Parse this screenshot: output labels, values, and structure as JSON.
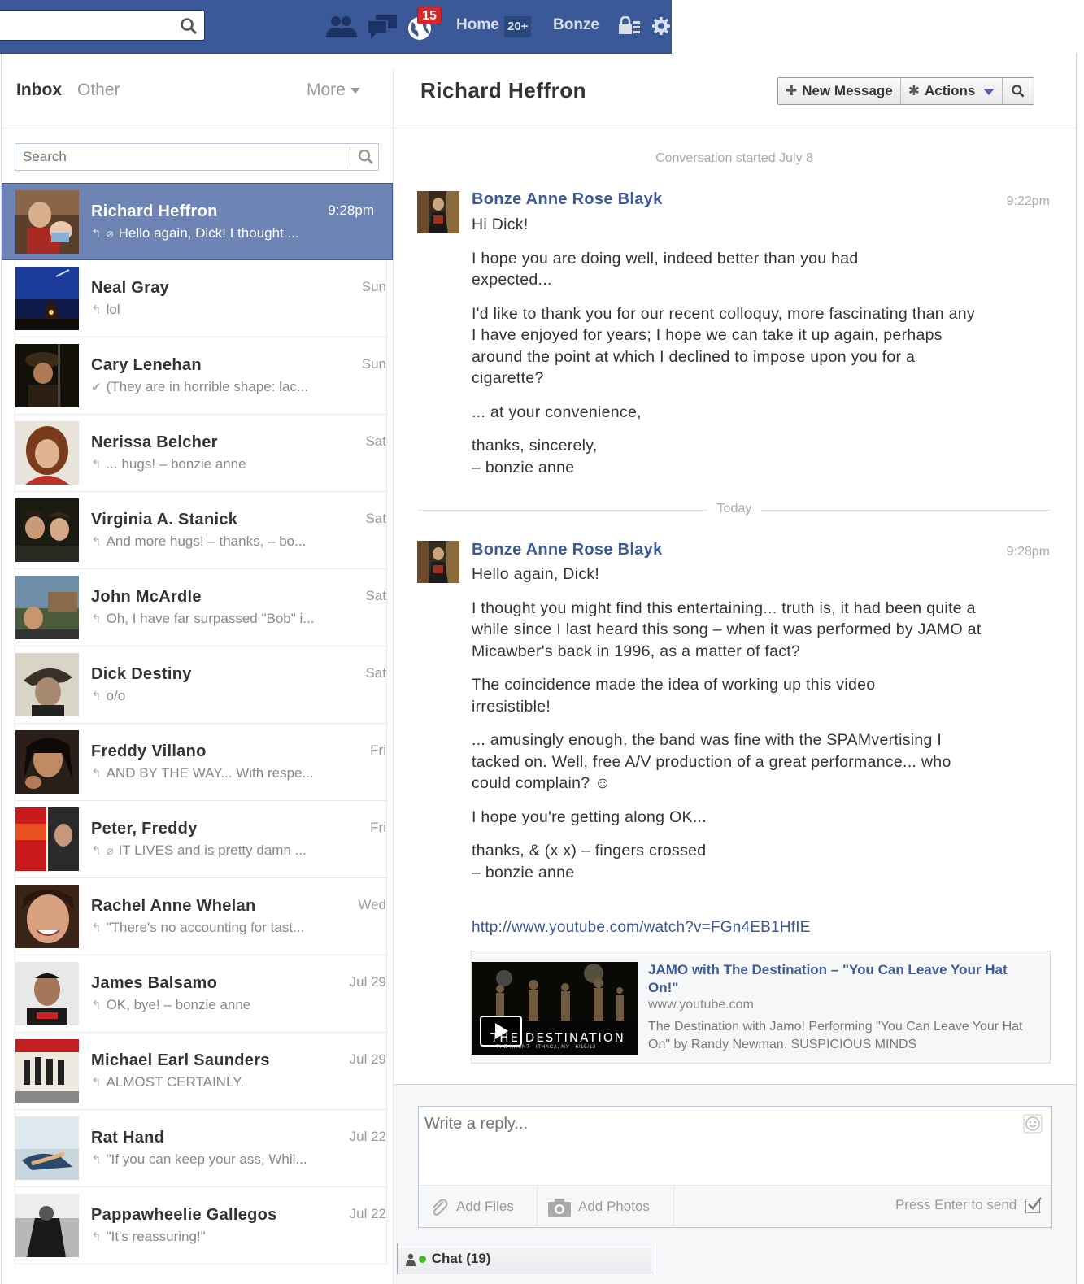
{
  "topbar": {
    "search_placeholder": "",
    "notifications_badge": "15",
    "home_label": "Home",
    "home_count": "20+",
    "profile_label": "Bonze",
    "icons": [
      "friend-requests-icon",
      "messages-icon",
      "notifications-globe-icon",
      "privacy-lock-icon",
      "settings-gear-icon"
    ]
  },
  "left": {
    "tab_inbox": "Inbox",
    "tab_other": "Other",
    "more_label": "More",
    "search_placeholder": "Search",
    "threads": [
      {
        "name": "Richard Heffron",
        "time": "9:28pm",
        "snippet": "Hello again, Dick! I thought ...",
        "icon": "reply-icon",
        "attachment": true,
        "selected": true
      },
      {
        "name": "Neal Gray",
        "time": "Sun",
        "snippet": "lol",
        "icon": "reply-icon",
        "attachment": false,
        "selected": false
      },
      {
        "name": "Cary Lenehan",
        "time": "Sun",
        "snippet": "(They are in horrible shape: lac...",
        "icon": "check-icon",
        "attachment": false,
        "selected": false
      },
      {
        "name": "Nerissa Belcher",
        "time": "Sat",
        "snippet": "... hugs! – bonzie anne",
        "icon": "reply-icon",
        "attachment": false,
        "selected": false
      },
      {
        "name": "Virginia A. Stanick",
        "time": "Sat",
        "snippet": "And more hugs! – thanks, – bo...",
        "icon": "reply-icon",
        "attachment": false,
        "selected": false
      },
      {
        "name": "John McArdle",
        "time": "Sat",
        "snippet": "Oh, I have far surpassed \"Bob\" i...",
        "icon": "reply-icon",
        "attachment": false,
        "selected": false
      },
      {
        "name": "Dick Destiny",
        "time": "Sat",
        "snippet": "o/o",
        "icon": "reply-icon",
        "attachment": false,
        "selected": false
      },
      {
        "name": "Freddy Villano",
        "time": "Fri",
        "snippet": "AND BY THE WAY... With respe...",
        "icon": "reply-icon",
        "attachment": false,
        "selected": false
      },
      {
        "name": "Peter, Freddy",
        "time": "Fri",
        "snippet": "IT LIVES and is pretty damn ...",
        "icon": "reply-icon",
        "attachment": true,
        "selected": false
      },
      {
        "name": "Rachel Anne Whelan",
        "time": "Wed",
        "snippet": "\"There's no accounting for tast...",
        "icon": "reply-icon",
        "attachment": false,
        "selected": false
      },
      {
        "name": "James Balsamo",
        "time": "Jul 29",
        "snippet": "OK, bye! – bonzie anne",
        "icon": "reply-icon",
        "attachment": false,
        "selected": false
      },
      {
        "name": "Michael Earl Saunders",
        "time": "Jul 29",
        "snippet": "ALMOST CERTAINLY.",
        "icon": "reply-icon",
        "attachment": false,
        "selected": false
      },
      {
        "name": "Rat Hand",
        "time": "Jul 22",
        "snippet": "\"If you can keep your ass, Whil...",
        "icon": "reply-icon",
        "attachment": false,
        "selected": false
      },
      {
        "name": "Pappawheelie Gallegos",
        "time": "Jul 22",
        "snippet": "\"It's reassuring!\"",
        "icon": "reply-icon",
        "attachment": false,
        "selected": false
      }
    ]
  },
  "conversation": {
    "title": "Richard Heffron",
    "new_message_label": "New Message",
    "actions_label": "Actions",
    "started_text": "Conversation started July 8",
    "today_label": "Today",
    "messages": [
      {
        "sender": "Bonze Anne Rose Blayk",
        "time": "9:22pm",
        "paragraphs": [
          "Hi Dick!",
          "I hope you are doing well, indeed better than you had expected...",
          "I'd like to thank you for our recent colloquy, more fascinating than any I have enjoyed for years; I hope we can take it up again, perhaps around the point at which I declined to impose upon you for a cigarette?",
          "... at your convenience,",
          "thanks, sincerely,\n– bonzie anne"
        ]
      },
      {
        "sender": "Bonze Anne Rose Blayk",
        "time": "9:28pm",
        "paragraphs": [
          "Hello again, Dick!",
          "I thought you might find this entertaining... truth is, it had been quite a while since I last heard this song – when it was performed by JAMO  at Micawber's back in 1996, as a matter of fact?",
          "The coincidence made the idea of working up this video irresistible!",
          "... amusingly enough, the band was fine with the SPAMvertising I tacked on.  Well, free A/V production of a great performance... who could complain? ☺",
          "I hope you're getting along OK...",
          "thanks, & (x x) – fingers crossed\n– bonzie anne"
        ],
        "link": "http://www.youtube.com/watch?v=FGn4EB1HfIE",
        "attachment": {
          "title": "JAMO with The Destination – \"You Can Leave Your Hat On!\"",
          "domain": "www.youtube.com",
          "description": "The Destination with Jamo! Performing \"You Can Leave Your Hat On\" by Randy Newman. SUSPICIOUS MINDS",
          "thumb_text": "THE DESTINATION",
          "thumb_subtext": "THE HAUNT · ITHACA, NY · 6/15/13"
        }
      }
    ]
  },
  "composer": {
    "placeholder": "Write a reply...",
    "add_files_label": "Add Files",
    "add_photos_label": "Add Photos",
    "press_enter_label": "Press Enter to send"
  },
  "chat": {
    "label": "Chat",
    "count": "(19)"
  },
  "colors": {
    "topbar": "#3b5998",
    "selected_thread": "#6d84b4",
    "link": "#3b5998",
    "badge": "#d8262b"
  }
}
